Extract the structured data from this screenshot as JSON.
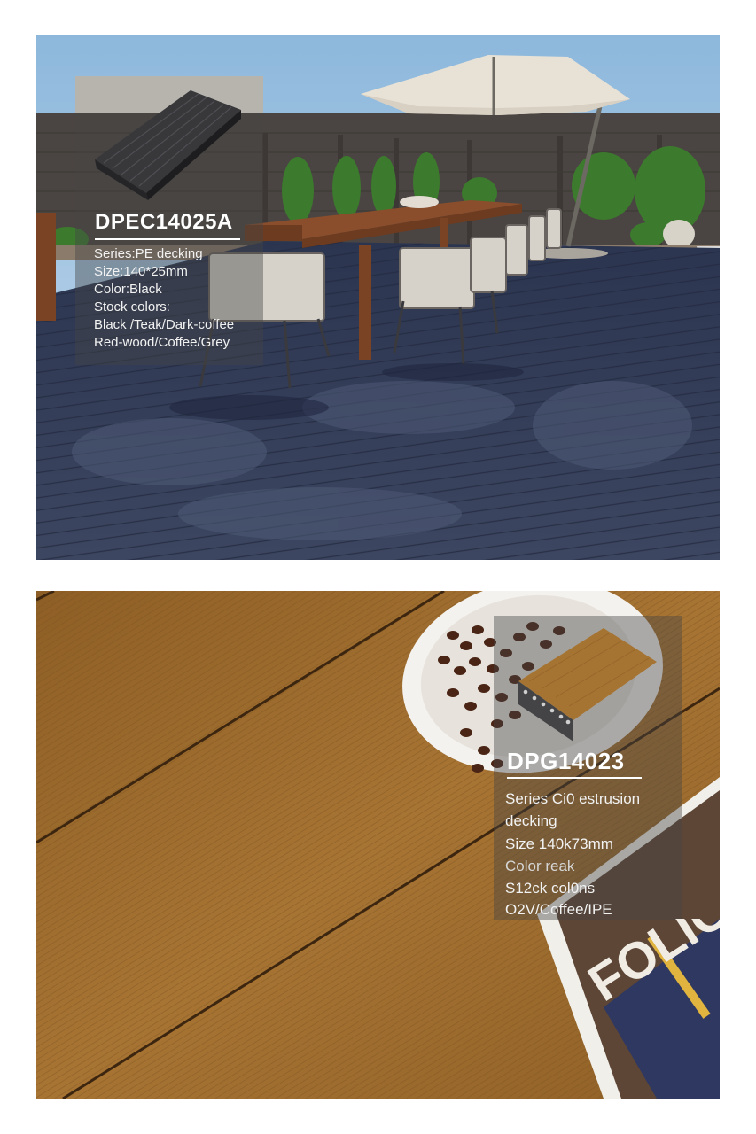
{
  "top_card": {
    "model": "DPEC14025A",
    "specs": [
      "Series:PE decking",
      "Size:140*25mm",
      "Color:Black",
      "Stock colors:",
      "Black /Teak/Dark-coffee",
      "Red-wood/Coffee/Grey"
    ]
  },
  "bottom_card": {
    "model": "DPG14023",
    "specs": [
      "Series Ci0 estrusion",
      "decking",
      "Size 140k73mm",
      "Color reak",
      "S12ck col0ns",
      "O2V/Coffee/IPE"
    ],
    "magazine_text": "FOLIO"
  },
  "colors": {
    "deck_black": "#2f3a52",
    "deck_teak": "#9a6a2c",
    "sky": "#9fc2e0"
  }
}
